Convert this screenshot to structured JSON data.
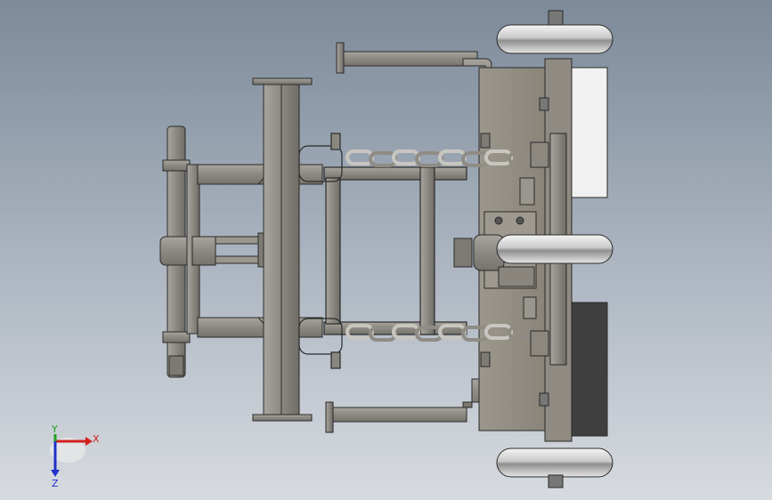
{
  "viewport": {
    "background_top": "#7d8a9a",
    "background_bottom": "#d7dbe0",
    "part_color": "#8d8a84",
    "edge_color": "#2a2a2a"
  },
  "triad": {
    "x_label": "X",
    "y_label": "Y",
    "z_label": "Z",
    "x_color": "#d42020",
    "y_color": "#1fa01f",
    "z_color": "#2030c8"
  }
}
